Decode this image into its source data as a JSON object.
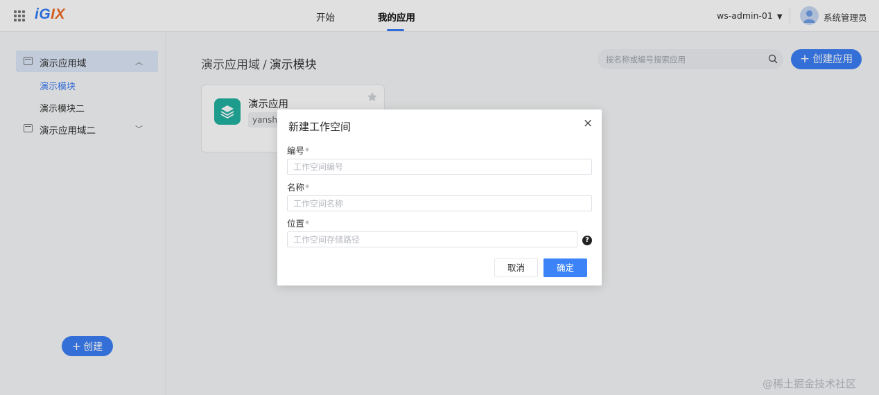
{
  "header": {
    "logo_part1": "iG",
    "logo_part2": "IX",
    "tabs": [
      {
        "label": "开始"
      },
      {
        "label": "我的应用",
        "active": true
      }
    ],
    "account": "ws-admin-01",
    "account_caret": "▼",
    "user_name": "系统管理员"
  },
  "sidebar": {
    "items": [
      {
        "label": "演示应用域",
        "chevron": "︿",
        "expanded": true
      },
      {
        "label": "演示应用域二",
        "chevron": "﹀",
        "expanded": false
      }
    ],
    "sub_items": [
      {
        "label": "演示模块",
        "selected": true
      },
      {
        "label": "演示模块二",
        "selected": false
      }
    ],
    "create_button": {
      "plus": "+",
      "label": "创建"
    }
  },
  "main": {
    "breadcrumb": {
      "parent": "演示应用域",
      "separator": "/",
      "current": "演示模块"
    },
    "search": {
      "placeholder": "按名称或编号搜索应用",
      "value": ""
    },
    "new_app_button": {
      "plus": "+",
      "label": "创建应用"
    },
    "app_card": {
      "name": "演示应用",
      "code": "yanshi"
    }
  },
  "modal": {
    "title": "新建工作空间",
    "close_glyph": "×",
    "fields": [
      {
        "label": "编号",
        "required_mark": "*",
        "placeholder": "工作空间编号",
        "value": ""
      },
      {
        "label": "名称",
        "required_mark": "*",
        "placeholder": "工作空间名称",
        "value": ""
      },
      {
        "label": "位置",
        "required_mark": "*",
        "placeholder": "工作空间存储路径",
        "value": ""
      }
    ],
    "help_glyph": "?",
    "cancel_label": "取消",
    "ok_label": "确定"
  },
  "watermark": "@稀土掘金技术社区",
  "colors": {
    "primary": "#3b7ff5",
    "logo_blue": "#2f7cf6",
    "logo_orange": "#f06a25",
    "app_icon_teal": "#22b2a2",
    "sidebar_active_bg": "#dde7f8"
  }
}
